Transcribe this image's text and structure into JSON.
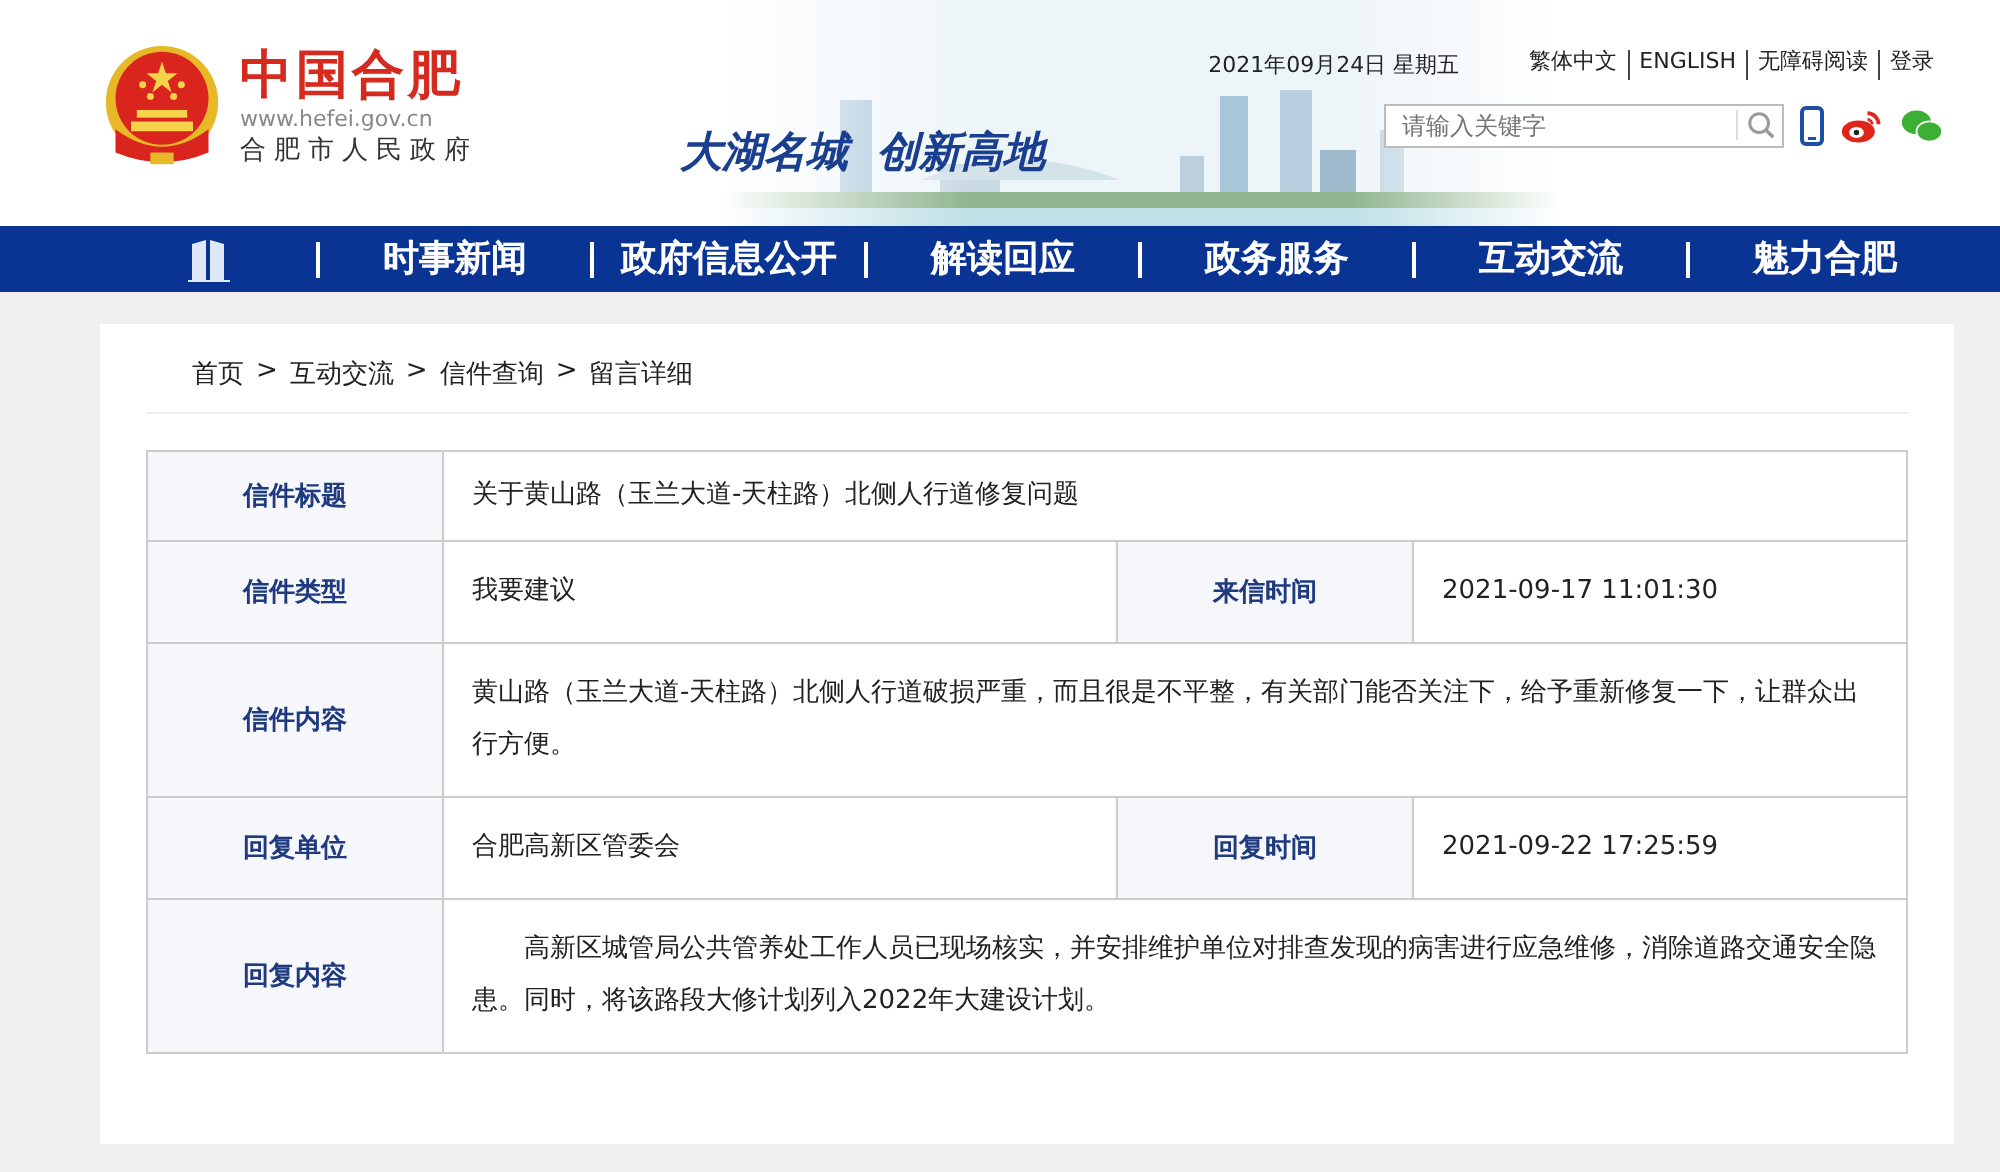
{
  "header": {
    "site_title": "中国合肥",
    "site_url": "www.hefei.gov.cn",
    "site_subtitle": "合肥市人民政府",
    "slogan": "大湖名城  创新高地",
    "date": "2021年09月24日 星期五",
    "links": [
      "繁体中文",
      "ENGLISH",
      "无障碍阅读",
      "登录"
    ],
    "search": {
      "placeholder": "请输入关键字"
    }
  },
  "nav": {
    "items": [
      "时事新闻",
      "政府信息公开",
      "解读回应",
      "政务服务",
      "互动交流",
      "魅力合肥"
    ]
  },
  "breadcrumb": {
    "items": [
      "首页",
      "互动交流",
      "信件查询",
      "留言详细"
    ],
    "separator": ">"
  },
  "details": {
    "rows": [
      {
        "cells": [
          {
            "label": "信件标题",
            "value": "关于黄山路（玉兰大道-天柱路）北侧人行道修复问题",
            "indent": false
          }
        ]
      },
      {
        "cells": [
          {
            "label": "信件类型",
            "value": "我要建议",
            "indent": false
          },
          {
            "label": "来信时间",
            "value": "2021-09-17 11:01:30",
            "indent": false
          }
        ]
      },
      {
        "cells": [
          {
            "label": "信件内容",
            "value": "黄山路（玉兰大道-天柱路）北侧人行道破损严重，而且很是不平整，有关部门能否关注下，给予重新修复一下，让群众出行方便。",
            "indent": false
          }
        ]
      },
      {
        "cells": [
          {
            "label": "回复单位",
            "value": "合肥高新区管委会",
            "indent": false
          },
          {
            "label": "回复时间",
            "value": "2021-09-22 17:25:59",
            "indent": false
          }
        ]
      },
      {
        "cells": [
          {
            "label": "回复内容",
            "value": "高新区城管局公共管养处工作人员已现场核实，并安排维护单位对排查发现的病害进行应急维修，消除道路交通安全隐患。同时，将该路段大修计划列入2022年大建设计划。",
            "indent": true
          }
        ]
      }
    ]
  }
}
